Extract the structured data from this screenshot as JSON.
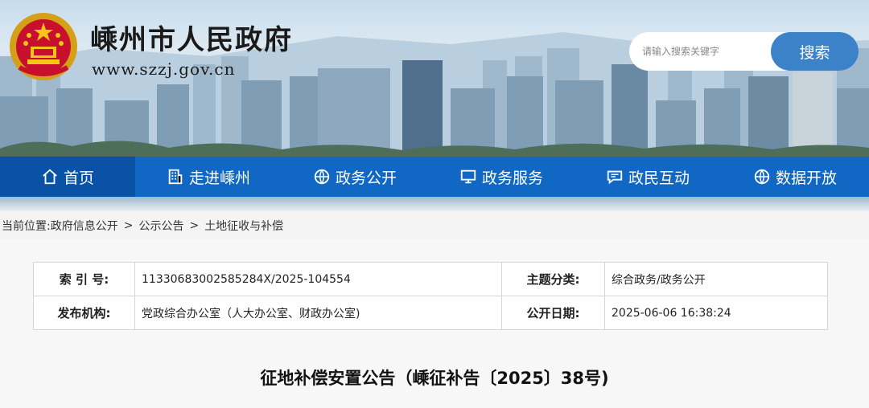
{
  "header": {
    "title": "嵊州市人民政府",
    "url": "www.szzj.gov.cn",
    "search_placeholder": "请输入搜索关键字",
    "search_button": "搜索"
  },
  "nav": {
    "items": [
      {
        "label": "首页",
        "icon": "home-icon"
      },
      {
        "label": "走进嵊州",
        "icon": "building-icon"
      },
      {
        "label": "政务公开",
        "icon": "globe-icon"
      },
      {
        "label": "政务服务",
        "icon": "monitor-icon"
      },
      {
        "label": "政民互动",
        "icon": "chat-icon"
      },
      {
        "label": "数据开放",
        "icon": "globe-icon"
      }
    ]
  },
  "breadcrumb": {
    "prefix": "当前位置:",
    "items": [
      "政府信息公开",
      "公示公告",
      "土地征收与补偿"
    ],
    "separator": ">"
  },
  "meta": {
    "index_label": "索 引 号:",
    "index_value": "11330683002585284X/2025-104554",
    "category_label": "主题分类:",
    "category_value": "综合政务/政务公开",
    "publisher_label": "发布机构:",
    "publisher_value": "党政综合办公室（人大办公室、财政办公室)",
    "date_label": "公开日期:",
    "date_value": "2025-06-06 16:38:24"
  },
  "document": {
    "title": "征地补偿安置公告（嵊征补告〔2025〕38号)"
  },
  "colors": {
    "nav_bg": "#1168c4",
    "nav_active": "#0a52a6",
    "search_button": "#3b82c8"
  }
}
